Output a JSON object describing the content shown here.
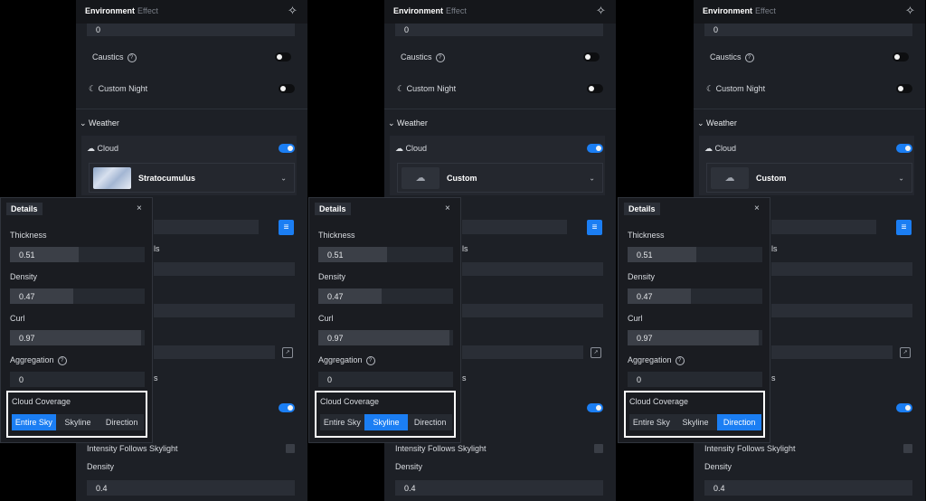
{
  "tabs": {
    "environment": "Environment",
    "effect": "Effect"
  },
  "icons": {
    "sparkle": "sparkle-icon",
    "help": "help-circle-icon",
    "moon": "moon-icon",
    "cloud": "cloud-icon",
    "chevron": "chevron-down-icon",
    "close": "close-icon",
    "sliders": "sliders-icon",
    "custom_cloud": "custom-cloud-icon",
    "expand": "expand-icon"
  },
  "accent_color": "#1b7ef3",
  "top_field_value": "0",
  "caustics_label": "Caustics",
  "custom_night_label": "Custom Night",
  "weather_title": "Weather",
  "cloud_label": "Cloud",
  "intensity_label": "Intensity Follows Skylight",
  "density_label": "Density",
  "density_value": "0.4",
  "partial_s_label": "ls",
  "partial_s2_label": "s",
  "details": {
    "title": "Details",
    "close": "×",
    "thickness_label": "Thickness",
    "thickness_value": "0.51",
    "thickness_fraction": 0.51,
    "density_label": "Density",
    "density_value": "0.47",
    "density_fraction": 0.47,
    "curl_label": "Curl",
    "curl_value": "0.97",
    "curl_fraction": 0.97,
    "aggregation_label": "Aggregation",
    "aggregation_value": "0",
    "coverage_label": "Cloud Coverage",
    "coverage_options": [
      "Entire Sky",
      "Skyline",
      "Direction"
    ]
  },
  "panels": [
    {
      "preset_label": "Stratocumulus",
      "preset_thumb": "sky-thumbnail",
      "selected_coverage": 0
    },
    {
      "preset_label": "Custom",
      "preset_thumb": "custom-cloud-icon",
      "selected_coverage": 1
    },
    {
      "preset_label": "Custom",
      "preset_thumb": "custom-cloud-icon",
      "selected_coverage": 2
    }
  ]
}
